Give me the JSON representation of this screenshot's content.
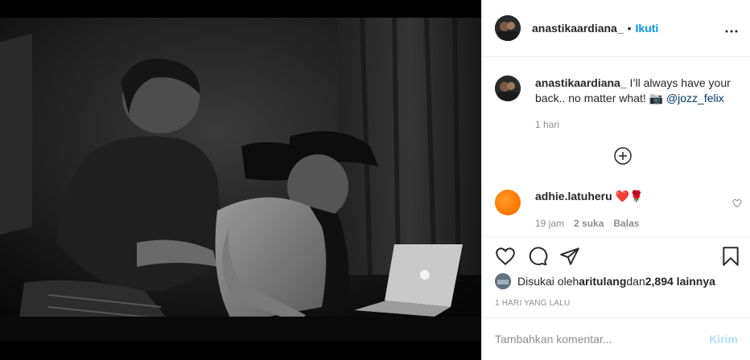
{
  "post": {
    "username": "anastikaardiana_",
    "dot": "•",
    "follow_label": "Ikuti",
    "more_label": "•••"
  },
  "caption": {
    "username": "anastikaardiana_",
    "text": " I’ll always have your back.. no matter what! 📷 ",
    "mention": "@jozz_felix",
    "time": "1 hari"
  },
  "comments": [
    {
      "username": "adhie.latuheru",
      "text": " ❤️🌹",
      "time": "19 jam",
      "likes": "2 suka",
      "reply_label": "Balas"
    }
  ],
  "likes": {
    "prefix": "Disukai oleh ",
    "user": "aritulang",
    "middle": " dan ",
    "count": "2,894 lainnya"
  },
  "post_time": "1 HARI YANG LALU",
  "comment_input": {
    "placeholder": "Tambahkan komentar...",
    "post_label": "Kirim"
  },
  "icons": {
    "more": "more-icon",
    "load_more": "plus-circle-icon",
    "like": "heart-icon",
    "comment": "comment-icon",
    "share": "share-icon",
    "save": "bookmark-icon"
  },
  "colors": {
    "link_blue": "#0095f6",
    "post_btn_disabled": "#b2dffc",
    "muted": "#8e8e8e",
    "text": "#262626"
  }
}
